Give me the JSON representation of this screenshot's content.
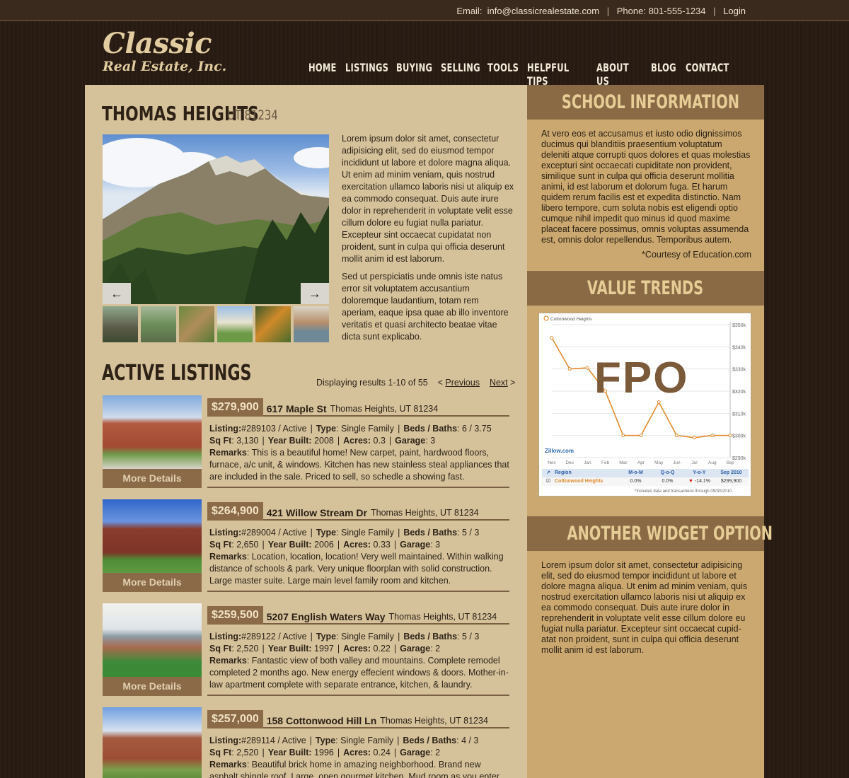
{
  "topbar": {
    "email_label": "Email:",
    "email": "info@classicrealestate.com",
    "phone_label": "Phone:",
    "phone": "801-555-1234",
    "login": "Login"
  },
  "logo": {
    "line1": "Classic",
    "line2": "Real Estate, Inc."
  },
  "nav": [
    "HOME",
    "LISTINGS",
    "BUYING",
    "SELLING",
    "TOOLS",
    "HELPFUL TIPS",
    "ABOUT US",
    "BLOG",
    "CONTACT"
  ],
  "page": {
    "title": "THOMAS HEIGHTS",
    "zip": "UT 81234"
  },
  "gallery": {
    "prev_icon": "left-arrow-icon",
    "next_icon": "right-arrow-icon",
    "thumb_count": 6
  },
  "intro": [
    "Lorem ipsum dolor sit amet, consectetur adipisicing elit, sed do eiusmod tempor incididunt ut labore et dolore magna aliqua. Ut enim ad minim veniam, quis nostrud exercitation ullamco laboris nisi ut aliquip ex ea commodo consequat. Duis aute irure dolor in reprehenderit in voluptate velit esse cillum dolore eu fugiat nulla pariatur. Excepteur sint occaecat cupidatat non proident, sunt in culpa qui officia deserunt mollit anim id est laborum.",
    "Sed ut perspiciatis unde omnis iste natus error sit voluptatem accusantium doloremque laudantium, totam rem aperiam, eaque ipsa quae ab illo inventore veritatis et quasi architecto beatae vitae dicta sunt explicabo."
  ],
  "listings_section": {
    "title": "ACTIVE LISTINGS",
    "results": "Displaying results 1-10 of 55",
    "prev": "Previous",
    "next": "Next"
  },
  "labels": {
    "listing": "Listing:",
    "type": "Type",
    "beds": "Beds / Baths",
    "sqft": "Sq Ft",
    "year": "Year Built:",
    "acres": "Acres:",
    "garage": "Garage",
    "remarks": "Remarks",
    "more": "More Details"
  },
  "listings": [
    {
      "price": "$279,900",
      "address": "617 Maple St",
      "city": "Thomas Heights, UT 81234",
      "listing": "#289103 / Active",
      "type": "Single Family",
      "beds": "6 / 3.75",
      "sqft": "3,130",
      "year": "2008",
      "acres": "0.3",
      "garage": "3",
      "remarks": "This is a beautiful home! New carpet, paint, hardwood floors, furnace, a/c unit, & windows. Kitchen has new stainless steal appliances that are included in the sale. Priced to sell, so schedle a showing fast."
    },
    {
      "price": "$264,900",
      "address": "421 Willow Stream Dr",
      "city": "Thomas Heights, UT 81234",
      "listing": "#289004 / Active",
      "type": "Single Family",
      "beds": "5 / 3",
      "sqft": "2,650",
      "year": "2006",
      "acres": "0.33",
      "garage": "3",
      "remarks": "Location, location, location!  Very well maintained. Within walking distance of schools & park. Very unique floorplan with solid construction. Large master suite. Large main level family room and kitchen."
    },
    {
      "price": "$259,500",
      "address": "5207 English Waters Way",
      "city": "Thomas Heights, UT 81234",
      "listing": "#289122 / Active",
      "type": "Single Family",
      "beds": "5 / 3",
      "sqft": "2,520",
      "year": "1997",
      "acres": "0.22",
      "garage": "2",
      "remarks": "Fantastic view of both valley and mountains. Complete remodel completed 2 months ago. New energy effecient windows & doors. Mother-in-law apartment complete with separate entrance, kitchen, & laundry."
    },
    {
      "price": "$257,000",
      "address": "158 Cottonwood Hill Ln",
      "city": "Thomas Heights, UT 81234",
      "listing": "#289114 / Active",
      "type": "Single Family",
      "beds": "4 / 3",
      "sqft": "2,520",
      "year": "1996",
      "acres": "0.24",
      "garage": "2",
      "remarks": "Beautiful brick home in amazing neighborhood. Brand new asphalt shingle roof. Large, open gourmet kitchen. Mud room as you enter home"
    }
  ],
  "sidebar": {
    "school_title": "SCHOOL INFORMATION",
    "school_text": "At vero eos et accusamus et iusto odio dignissimos ducimus qui blanditiis praesentium voluptatum deleniti atque corrupti quos dolores et quas molestias excepturi sint occaecati cupiditate non provident, similique sunt in culpa qui officia deserunt mollitia animi, id est laborum et dolorum fuga. Et harum quidem rerum facilis est et expedita distinctio. Nam libero tempore, cum soluta nobis est eligendi optio cumque nihil impedit quo minus id quod maxime placeat facere possimus, omnis voluptas assumenda est, omnis dolor repellendus. Temporibus autem.",
    "school_credit": "*Courtesy of Education.com",
    "value_title": "VALUE TRENDS",
    "fpo": "FPO",
    "zillow": "Zillow.com",
    "widget_title": "ANOTHER WIDGET OPTION",
    "widget_text": "Lorem ipsum dolor sit amet, consectetur adipisicing elit, sed do eiusmod tempor incididunt ut labore et dolore magna aliqua. Ut enim ad minim veniam, quis nostrud exercitation ullamco laboris nisi ut aliquip ex ea commodo consequat. Duis aute irure dolor in reprehenderit in voluptate velit esse cillum dolore eu fugiat nulla pariatur. Excepteur sint occaecat cupid-atat non proident, sunt in culpa qui officia deserunt mollit anim id est laborum."
  },
  "chart_data": {
    "type": "line",
    "legend": "Cottonwood Heights",
    "x": [
      "Nov",
      "Dec",
      "Jan",
      "Feb",
      "Mar",
      "Apr",
      "May",
      "Jun",
      "Jul",
      "Aug",
      "Sep"
    ],
    "series": [
      {
        "name": "Cottonwood Heights",
        "values": [
          344,
          330,
          330.5,
          320,
          300,
          300,
          315,
          300,
          299,
          300,
          300
        ]
      }
    ],
    "yticks": [
      "$350k",
      "$340k",
      "$330k",
      "$320k",
      "$310k",
      "$300k",
      "$290k"
    ],
    "ylim": [
      290,
      350
    ],
    "color": "#e28a2b",
    "table": {
      "headers": [
        "Region",
        "M-o-M",
        "Q-o-Q",
        "Y-o-Y",
        "Sep 2010"
      ],
      "row": [
        "Cottonwood Heights",
        "0.0%",
        "0.0%",
        "-14.1%",
        "$299,900"
      ]
    },
    "note": "*Includes data and transactions through 09/30/2010"
  }
}
